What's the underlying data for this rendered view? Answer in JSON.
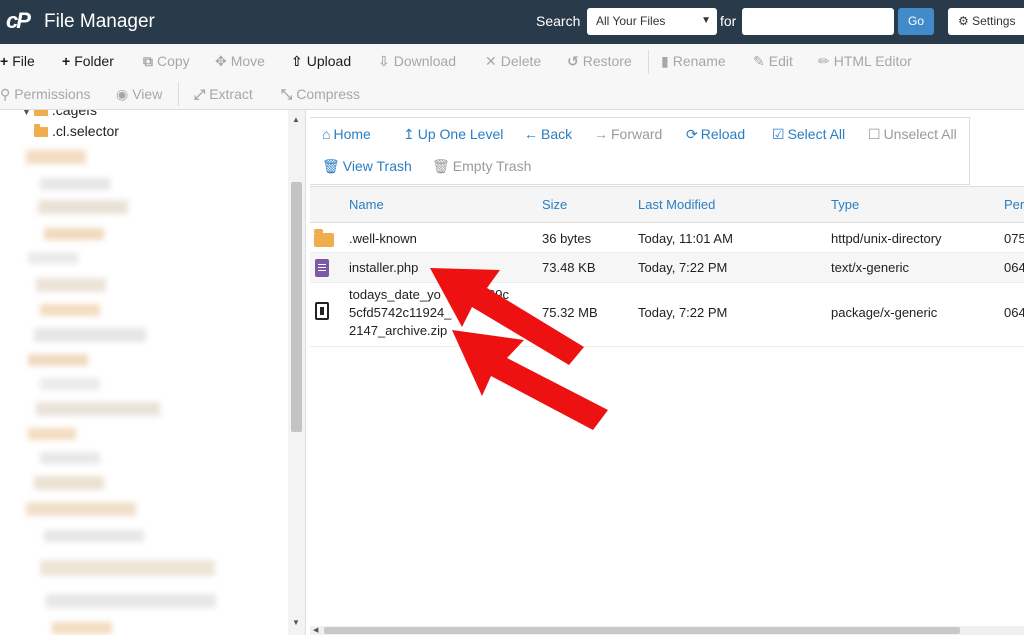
{
  "header": {
    "logo": "cP",
    "title": "File Manager",
    "search_label": "Search",
    "search_scope": "All Your Files",
    "for_label": "for",
    "search_value": "",
    "go_label": "Go",
    "settings_label": "Settings"
  },
  "toolbar": {
    "file": "File",
    "folder": "Folder",
    "copy": "Copy",
    "move": "Move",
    "upload": "Upload",
    "download": "Download",
    "delete": "Delete",
    "restore": "Restore",
    "rename": "Rename",
    "edit": "Edit",
    "html_editor": "HTML Editor",
    "permissions": "Permissions",
    "view": "View",
    "extract": "Extract",
    "compress": "Compress"
  },
  "sidebar": {
    "items": [
      {
        "label": ".cagefs"
      },
      {
        "label": ".cl.selector"
      }
    ]
  },
  "nav": {
    "home": "Home",
    "up_one_level": "Up One Level",
    "back": "Back",
    "forward": "Forward",
    "reload": "Reload",
    "select_all": "Select All",
    "unselect_all": "Unselect All",
    "view_trash": "View Trash",
    "empty_trash": "Empty Trash"
  },
  "table": {
    "columns": {
      "name": "Name",
      "size": "Size",
      "modified": "Last Modified",
      "type": "Type",
      "perms": "Per"
    },
    "rows": [
      {
        "name": ".well-known",
        "size": "36 bytes",
        "modified": "Today, 11:01 AM",
        "type": "httpd/unix-directory",
        "perms": "075",
        "icon": "folder-icon"
      },
      {
        "name": "installer.php",
        "size": "73.48 KB",
        "modified": "Today, 7:22 PM",
        "type": "text/x-generic",
        "perms": "064",
        "icon": "php-file-icon"
      },
      {
        "name": "todays_date_yo…269c5cfd5742c11924_2025…162147_archive.zip",
        "name_line1": "todays_date_yo",
        "name_line1b": "269c",
        "name_line2": "5cfd5742c11924_",
        "name_line2b": "16",
        "name_line3": "2147_archive.zip",
        "size": "75.32 MB",
        "modified": "Today, 7:22 PM",
        "type": "package/x-generic",
        "perms": "064",
        "icon": "zip-file-icon"
      }
    ]
  },
  "colors": {
    "header_bg": "#293a4a",
    "accent_blue": "#2a7ec1",
    "go_button": "#428bca",
    "folder": "#f0ad4e",
    "arrow_red": "#ee1111"
  }
}
